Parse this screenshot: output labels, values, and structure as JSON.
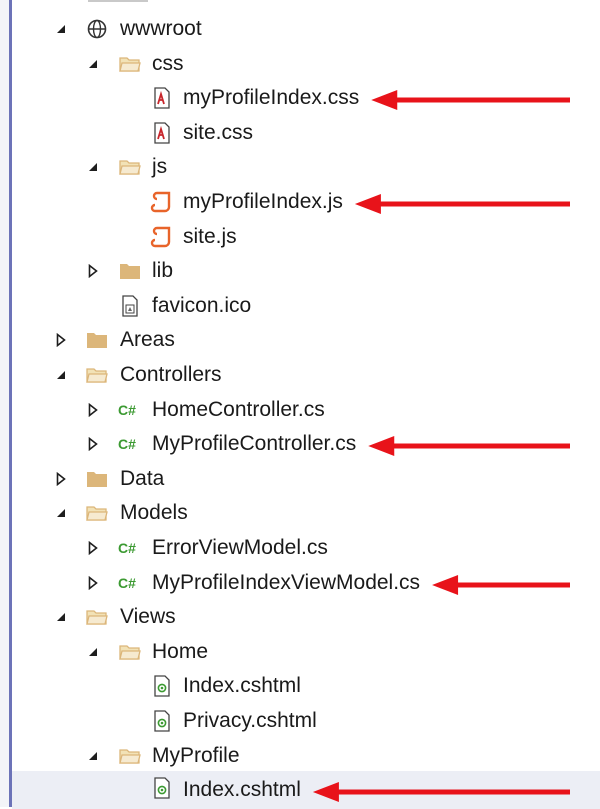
{
  "tree": [
    {
      "label": "wwwroot",
      "level": 0,
      "expander": "expanded",
      "icon": "globe-icon"
    },
    {
      "label": "css",
      "level": 1,
      "expander": "expanded",
      "icon": "folder-open-icon"
    },
    {
      "label": "myProfileIndex.css",
      "level": 2,
      "expander": "none",
      "icon": "css-file-icon"
    },
    {
      "label": "site.css",
      "level": 2,
      "expander": "none",
      "icon": "css-file-icon"
    },
    {
      "label": "js",
      "level": 1,
      "expander": "expanded",
      "icon": "folder-open-icon"
    },
    {
      "label": "myProfileIndex.js",
      "level": 2,
      "expander": "none",
      "icon": "js-file-icon"
    },
    {
      "label": "site.js",
      "level": 2,
      "expander": "none",
      "icon": "js-file-icon"
    },
    {
      "label": "lib",
      "level": 1,
      "expander": "collapsed",
      "icon": "folder-icon"
    },
    {
      "label": "favicon.ico",
      "level": 1,
      "expander": "none",
      "icon": "ico-file-icon"
    },
    {
      "label": "Areas",
      "level": 0,
      "expander": "collapsed",
      "icon": "folder-icon"
    },
    {
      "label": "Controllers",
      "level": 0,
      "expander": "expanded",
      "icon": "folder-open-icon"
    },
    {
      "label": "HomeController.cs",
      "level": 1,
      "expander": "collapsed",
      "icon": "csharp-file-icon"
    },
    {
      "label": "MyProfileController.cs",
      "level": 1,
      "expander": "collapsed",
      "icon": "csharp-file-icon"
    },
    {
      "label": "Data",
      "level": 0,
      "expander": "collapsed",
      "icon": "folder-icon"
    },
    {
      "label": "Models",
      "level": 0,
      "expander": "expanded",
      "icon": "folder-open-icon"
    },
    {
      "label": "ErrorViewModel.cs",
      "level": 1,
      "expander": "collapsed",
      "icon": "csharp-file-icon"
    },
    {
      "label": "MyProfileIndexViewModel.cs",
      "level": 1,
      "expander": "collapsed",
      "icon": "csharp-file-icon"
    },
    {
      "label": "Views",
      "level": 0,
      "expander": "expanded",
      "icon": "folder-open-icon"
    },
    {
      "label": "Home",
      "level": 1,
      "expander": "expanded",
      "icon": "folder-open-icon"
    },
    {
      "label": "Index.cshtml",
      "level": 2,
      "expander": "none",
      "icon": "razor-file-icon"
    },
    {
      "label": "Privacy.cshtml",
      "level": 2,
      "expander": "none",
      "icon": "razor-file-icon"
    },
    {
      "label": "MyProfile",
      "level": 1,
      "expander": "expanded",
      "icon": "folder-open-icon"
    },
    {
      "label": "Index.cshtml",
      "level": 2,
      "expander": "none",
      "icon": "razor-file-icon",
      "selected": true
    }
  ],
  "csharp_icon_text": "C#",
  "highlighted_items": [
    "myProfileIndex.css",
    "myProfileIndex.js",
    "MyProfileController.cs",
    "MyProfileIndexViewModel.cs",
    "Index.cshtml"
  ],
  "colors": {
    "arrow": "#e8131a",
    "folder": "#dcb67a",
    "csharp": "#3c9a32",
    "js": "#e8642a",
    "css": "#c8262c",
    "razor": "#3c9a32",
    "selection": "#eceef5"
  }
}
